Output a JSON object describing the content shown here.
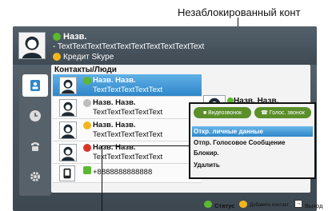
{
  "callout": {
    "text": "Незаблокированный конт"
  },
  "header": {
    "name": "Назв.",
    "mood": "- TextTextTextTextTextTextTextTextTextText",
    "credit": "Кредит Skype"
  },
  "panel": {
    "title": "Контакты/Люди"
  },
  "contacts": [
    {
      "name": "Назв. Назв.",
      "mood": "TextTextTextTextText",
      "status": "online",
      "status_color": "#5cb82e",
      "selected": true
    },
    {
      "name": "Назв. Назв.",
      "mood": "TextTextTextTextText",
      "status": "offline",
      "status_color": "#bdbdbd",
      "selected": false
    },
    {
      "name": "Назв. Назв.",
      "mood": "TextTextTextTextText",
      "status": "away",
      "status_color": "#f2b61d",
      "selected": false
    },
    {
      "name": "Назв. Назв.",
      "mood": "TextTextTextTextText",
      "status": "busy",
      "status_color": "#d9352b",
      "selected": false
    },
    {
      "name": "",
      "mood": "+8888888888888",
      "status": "phone",
      "status_color": "#5cb82e",
      "selected": false
    }
  ],
  "detail": {
    "name": "Назв. Назв."
  },
  "actions": {
    "video_call": "Видеозвонок",
    "voice_call": "Голос. звонок"
  },
  "menu": [
    {
      "label": "Откр. личные данные",
      "selected": true
    },
    {
      "label": "Отпр. Голосовое Сообщение",
      "selected": false
    },
    {
      "label": "Блокир.",
      "selected": false
    },
    {
      "label": "Удалить",
      "selected": false
    }
  ],
  "footer": {
    "status": "Статус",
    "add_contact": "Добавить контакт",
    "exit": "Выход"
  },
  "colors": {
    "accent": "#2f86c8",
    "online": "#5cb82e",
    "button": "#5a8f2a"
  }
}
